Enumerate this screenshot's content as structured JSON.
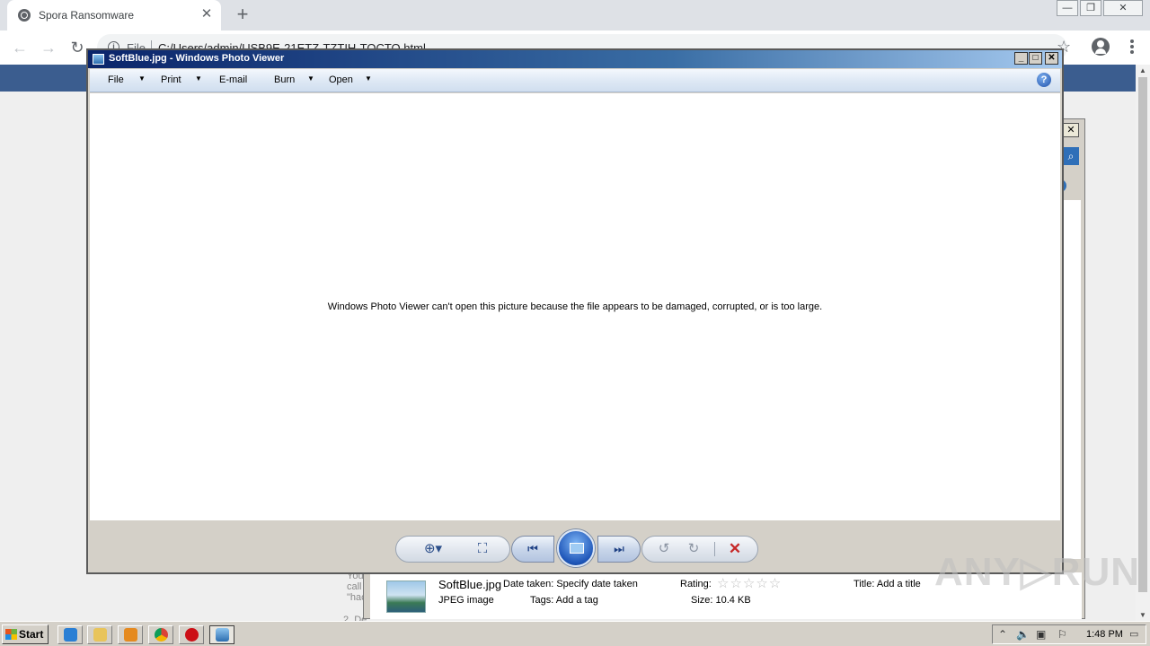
{
  "browser": {
    "tab_title": "Spora Ransomware",
    "tab_close": "✕",
    "new_tab": "+",
    "omnibox_scheme": "File",
    "omnibox_url": "C:/Users/admin/USB9E-21ETZ-TZTIH-TOCTO.html",
    "window_controls": [
      "—",
      "❐",
      "✕"
    ]
  },
  "background_page": {
    "fragment_lines": [
      "You",
      "call",
      "\"hac"
    ],
    "fragment_line2": "2. De"
  },
  "photo_viewer": {
    "title": "SoftBlue.jpg - Windows Photo Viewer",
    "title_buttons": [
      "_",
      "□",
      "✕"
    ],
    "menu": [
      {
        "label": "File",
        "has_dropdown": true
      },
      {
        "label": "Print",
        "has_dropdown": true
      },
      {
        "label": "E-mail",
        "has_dropdown": false
      },
      {
        "label": "Burn",
        "has_dropdown": true
      },
      {
        "label": "Open",
        "has_dropdown": true
      }
    ],
    "help_label": "?",
    "error_message": "Windows Photo Viewer can't open this picture because the file appears to be damaged, corrupted, or is too large.",
    "controls": {
      "zoom_icon": "zoom-icon",
      "actual_size_icon": "actual-size-icon",
      "previous_icon": "previous-icon",
      "slideshow_icon": "slideshow-icon",
      "next_icon": "next-icon",
      "rotate_ccw_icon": "rotate-counterclockwise-icon",
      "rotate_cw_icon": "rotate-clockwise-icon",
      "delete_icon": "delete-icon"
    }
  },
  "info_pane": {
    "filename": "SoftBlue.jpg",
    "file_type": "JPEG image",
    "date_taken": "Date taken: Specify date taken",
    "tags": "Tags: Add a tag",
    "rating_label": "Rating:",
    "rating_value": 0,
    "size": "Size: 10.4 KB",
    "title": "Title: Add a title"
  },
  "taskbar": {
    "start_label": "Start",
    "clock": "1:48 PM"
  },
  "watermark": "ANY▷RUN",
  "colors": {
    "titlebar_start": "#0a246a",
    "delete_red": "#c62828",
    "page_header": "#3b5d8f"
  }
}
